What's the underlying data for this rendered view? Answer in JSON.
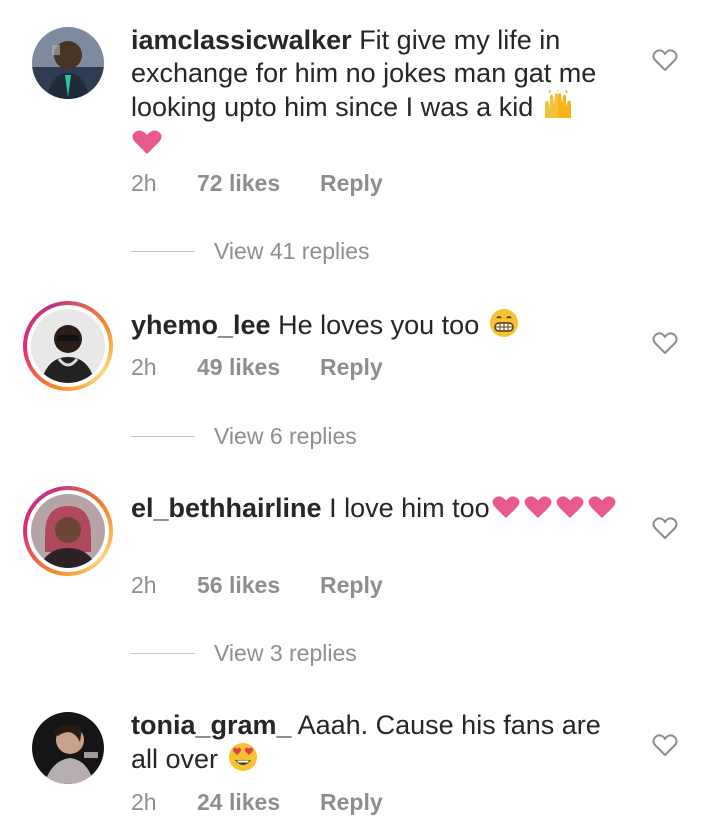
{
  "comments": [
    {
      "username": "iamclassicwalker",
      "text": "Fit give my life in exchange for him no jokes man gat me looking upto him since I was a kid",
      "time": "2h",
      "likes": "72 likes",
      "reply_label": "Reply",
      "view_replies": "View 41 replies"
    },
    {
      "username": "yhemo_lee",
      "text": "He loves you too",
      "time": "2h",
      "likes": "49 likes",
      "reply_label": "Reply",
      "view_replies": "View 6 replies"
    },
    {
      "username": "el_bethhairline",
      "text": "I love him too",
      "time": "2h",
      "likes": "56 likes",
      "reply_label": "Reply",
      "view_replies": "View 3 replies"
    },
    {
      "username": "tonia_gram_",
      "text": "Aaah. Cause his fans are all over",
      "time": "2h",
      "likes": "24 likes",
      "reply_label": "Reply"
    }
  ],
  "icons": {
    "like": "heart-outline-icon",
    "emoji_1": "raising-hands-emoji",
    "emoji_2": "pink-heart-emoji",
    "emoji_3": "grinning-face-emoji",
    "emoji_4": "heart-eyes-emoji"
  },
  "colors": {
    "text": "#262626",
    "secondary": "#8e8e8e",
    "heart_pink": "#e85a8f",
    "story_ring": "#dd2a7b"
  }
}
